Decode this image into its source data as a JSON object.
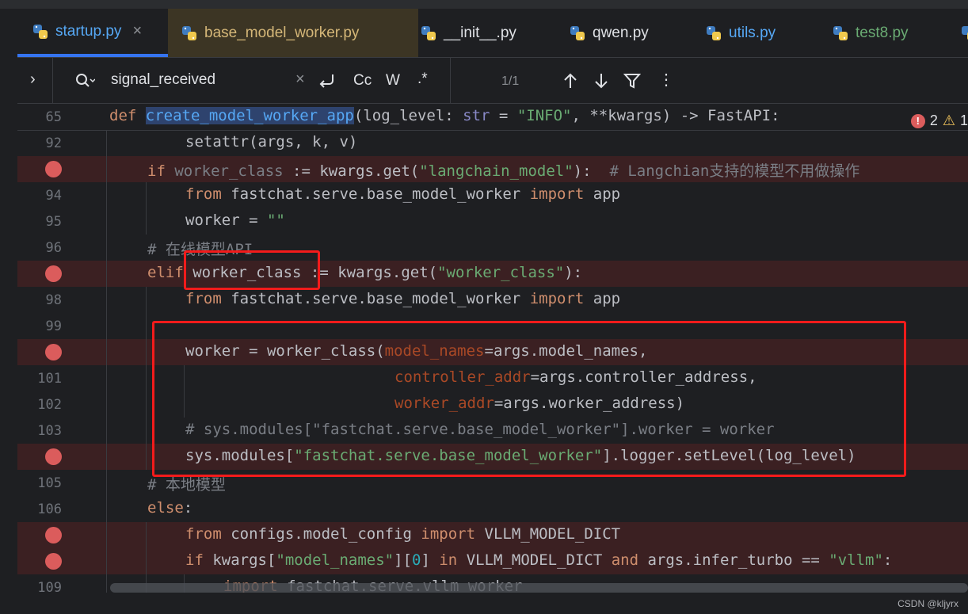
{
  "tabs": [
    {
      "label": "startup.py",
      "color": "#56a8f5",
      "active": true,
      "closable": true
    },
    {
      "label": "base_model_worker.py",
      "color": "#d5b778"
    },
    {
      "label": "__init__.py",
      "color": "#dfe1e5"
    },
    {
      "label": "qwen.py",
      "color": "#dfe1e5"
    },
    {
      "label": "utils.py",
      "color": "#56a8f5"
    },
    {
      "label": "test8.py",
      "color": "#6aab73"
    }
  ],
  "find": {
    "query": "signal_received",
    "match_case": "Cc",
    "words": "W",
    "regex": ".*",
    "count": "1/1"
  },
  "inspections": {
    "errors": "2",
    "warnings": "1"
  },
  "sticky": {
    "line_number": "65"
  },
  "lines": [
    {
      "n": "92"
    },
    {
      "n": "",
      "bp": true
    },
    {
      "n": "94"
    },
    {
      "n": "95"
    },
    {
      "n": "96"
    },
    {
      "n": "",
      "bp": true
    },
    {
      "n": "98"
    },
    {
      "n": "99"
    },
    {
      "n": "",
      "bp": true
    },
    {
      "n": "101"
    },
    {
      "n": "102"
    },
    {
      "n": "103"
    },
    {
      "n": "",
      "bp": true
    },
    {
      "n": "105"
    },
    {
      "n": "106"
    },
    {
      "n": "",
      "bp": true
    },
    {
      "n": "",
      "bp": true
    },
    {
      "n": "109"
    }
  ],
  "code": {
    "sticky": {
      "def": "def ",
      "name": "create_model_worker_app",
      "p1": "(log_level: ",
      "t1": "str",
      "p2": " = ",
      "s1": "\"INFO\"",
      "p3": ", **kwargs) -> FastAPI:"
    },
    "l92": {
      "a": "setattr",
      "b": "(args, k, v)"
    },
    "l93": {
      "kw": "if ",
      "v": "worker_class",
      "b": " := kwargs.get(",
      "s": "\"langchain_model\"",
      "c": "):  ",
      "cm": "# Langchian支持的模型不用做操作"
    },
    "l94": {
      "kw1": "from ",
      "m": "fastchat.serve.base_model_worker ",
      "kw2": "import ",
      "n": "app"
    },
    "l95": {
      "a": "worker = ",
      "s": "\"\""
    },
    "l96": {
      "cm": "# 在线模型API"
    },
    "l97": {
      "kw": "elif ",
      "v": "worker_class",
      "b": " := kwargs.get(",
      "s": "\"worker_class\"",
      "c": "):"
    },
    "l98": {
      "kw1": "from ",
      "m": "fastchat.serve.base_model_worker ",
      "kw2": "import ",
      "n": "app"
    },
    "l100": {
      "a": "worker = worker_class(",
      "k": "model_names",
      "b": "=args.model_names,"
    },
    "l101": {
      "k": "controller_addr",
      "b": "=args.controller_address,"
    },
    "l102": {
      "k": "worker_addr",
      "b": "=args.worker_address)"
    },
    "l103": {
      "cm": "# sys.modules[\"fastchat.serve.base_model_worker\"].worker = worker"
    },
    "l104": {
      "a": "sys.modules[",
      "s": "\"fastchat.serve.base_model_worker\"",
      "b": "].logger.setLevel(log_level)"
    },
    "l105": {
      "cm": "# 本地模型"
    },
    "l106": {
      "kw": "else",
      "b": ":"
    },
    "l107": {
      "kw1": "from ",
      "m": "configs.model_config ",
      "kw2": "import ",
      "n": "VLLM_MODEL_DICT"
    },
    "l108": {
      "kw": "if ",
      "a": "kwargs[",
      "s": "\"model_names\"",
      "b": "][",
      "num": "0",
      "c": "] ",
      "kw2": "in ",
      "d": "VLLM_MODEL_DICT ",
      "kw3": "and ",
      "e": "args.infer_turbo == ",
      "s2": "\"vllm\"",
      "f": ":"
    },
    "l109": {
      "kw": "import ",
      "b": "fastchat.serve.vllm_worker"
    }
  },
  "watermark": "CSDN @kljyrx"
}
